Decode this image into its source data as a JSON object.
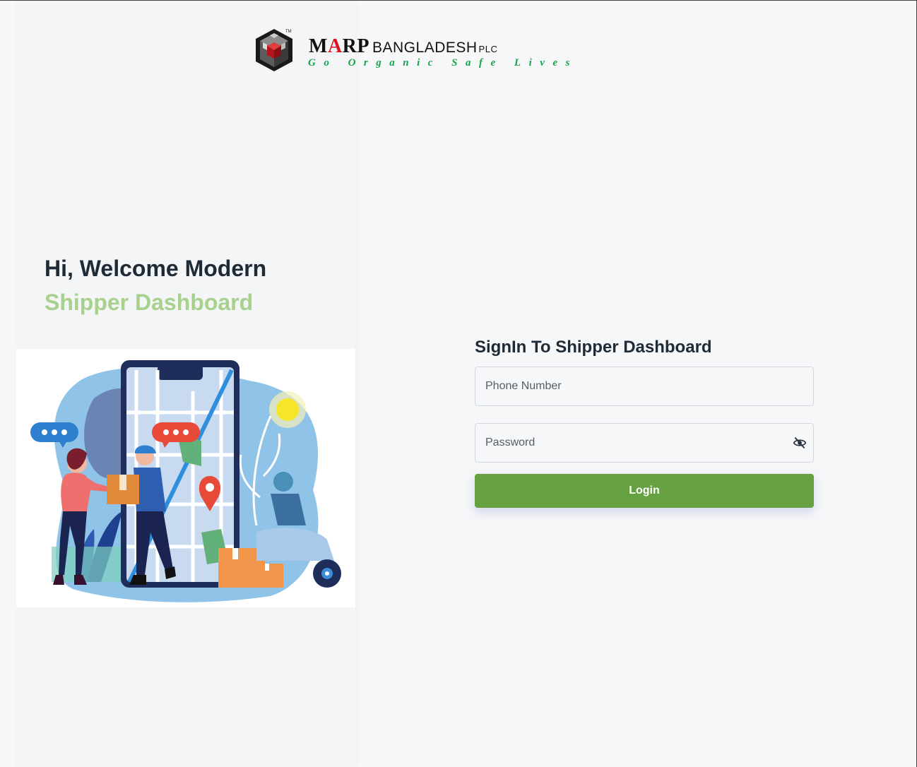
{
  "logo": {
    "brand_prefix": "M",
    "brand_accent": "A",
    "brand_suffix": "RP",
    "brand_country": "BANGLADESH",
    "brand_plc": "PLC",
    "trademark": "TM",
    "tagline": "Go Organic Safe Lives"
  },
  "welcome": {
    "line1": "Hi, Welcome Modern",
    "line2": "Shipper Dashboard"
  },
  "form": {
    "title": "SignIn To Shipper Dashboard",
    "phone_placeholder": "Phone Number",
    "password_placeholder": "Password",
    "login_label": "Login"
  },
  "icons": {
    "password_toggle": "eye-off-icon",
    "logo_mark": "cube-logo-icon"
  },
  "colors": {
    "accent_green": "#66a141",
    "welcome_subtitle": "#a9d18e",
    "logo_red": "#d7151e",
    "tagline_green": "#17a34a"
  }
}
